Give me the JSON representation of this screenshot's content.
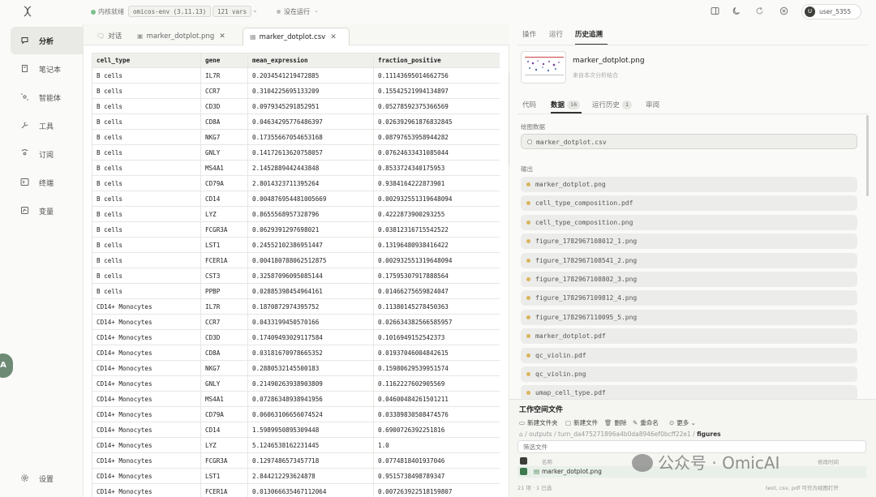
{
  "topbar": {
    "kernel_status": "内核就绪",
    "env_chip": "omicos-env (3.11.13)",
    "vars_chip": "121 vars",
    "run_status": "没在运行",
    "user_initial": "U",
    "user_name": "user_5355"
  },
  "sidebar": {
    "items": [
      {
        "label": "分析",
        "icon": "chat-icon"
      },
      {
        "label": "笔记本",
        "icon": "notebook-icon"
      },
      {
        "label": "智能体",
        "icon": "agent-icon"
      },
      {
        "label": "工具",
        "icon": "wrench-icon"
      },
      {
        "label": "订阅",
        "icon": "subscribe-icon"
      },
      {
        "label": "终端",
        "icon": "terminal-icon"
      },
      {
        "label": "变量",
        "icon": "variable-icon"
      }
    ],
    "settings_label": "设置",
    "float_letter": "A"
  },
  "center": {
    "tabs": [
      {
        "label": "对话",
        "icon": "chat-icon"
      },
      {
        "label": "marker_dotplot.png",
        "icon": "image-icon"
      },
      {
        "label": "marker_dotplot.csv",
        "icon": "table-icon"
      }
    ],
    "table": {
      "headers": [
        "cell_type",
        "gene",
        "mean_expression",
        "fraction_positive"
      ],
      "rows": [
        [
          "B cells",
          "IL7R",
          "0.2034541219472885",
          "0.11143695014662756"
        ],
        [
          "B cells",
          "CCR7",
          "0.3104225695133209",
          "0.15542521994134897"
        ],
        [
          "B cells",
          "CD3D",
          "0.0979345291852951",
          "0.05278592375366569"
        ],
        [
          "B cells",
          "CD8A",
          "0.04634295776486397",
          "0.026392961876832845"
        ],
        [
          "B cells",
          "NKG7",
          "0.17355667054653168",
          "0.08797653958944282"
        ],
        [
          "B cells",
          "GNLY",
          "0.14172613620758057",
          "0.07624633431085044"
        ],
        [
          "B cells",
          "MS4A1",
          "2.1452889442443848",
          "0.8533724340175953"
        ],
        [
          "B cells",
          "CD79A",
          "2.8014323711395264",
          "0.9384164222873901"
        ],
        [
          "B cells",
          "CD14",
          "0.004876954481005669",
          "0.002932551319648094"
        ],
        [
          "B cells",
          "LYZ",
          "0.8655568957328796",
          "0.4222873900293255"
        ],
        [
          "B cells",
          "FCGR3A",
          "0.0629391297698021",
          "0.03812316715542522"
        ],
        [
          "B cells",
          "LST1",
          "0.24552102386951447",
          "0.13196480938416422"
        ],
        [
          "B cells",
          "FCER1A",
          "0.004180788062512875",
          "0.002932551319648094"
        ],
        [
          "B cells",
          "CST3",
          "0.32587096095085144",
          "0.17595307917888564"
        ],
        [
          "B cells",
          "PPBP",
          "0.02885398454964161",
          "0.01466275659824047"
        ],
        [
          "CD14+ Monocytes",
          "IL7R",
          "0.1870872974395752",
          "0.11380145278450363"
        ],
        [
          "CD14+ Monocytes",
          "CCR7",
          "0.0433199450570166",
          "0.026634382566585957"
        ],
        [
          "CD14+ Monocytes",
          "CD3D",
          "0.17409493029117584",
          "0.1016949152542373"
        ],
        [
          "CD14+ Monocytes",
          "CD8A",
          "0.03181670978665352",
          "0.01937046004842615"
        ],
        [
          "CD14+ Monocytes",
          "NKG7",
          "0.2880532145500183",
          "0.15980629539951574"
        ],
        [
          "CD14+ Monocytes",
          "GNLY",
          "0.21490263938903809",
          "0.1162227602905569"
        ],
        [
          "CD14+ Monocytes",
          "MS4A1",
          "0.07286348938941956",
          "0.04600484261501211"
        ],
        [
          "CD14+ Monocytes",
          "CD79A",
          "0.06063106656074524",
          "0.03389830508474576"
        ],
        [
          "CD14+ Monocytes",
          "CD14",
          "1.5989950895309448",
          "0.6900726392251816"
        ],
        [
          "CD14+ Monocytes",
          "LYZ",
          "5.1246538162231445",
          "1.0"
        ],
        [
          "CD14+ Monocytes",
          "FCGR3A",
          "0.1297486573457718",
          "0.0774818401937046"
        ],
        [
          "CD14+ Monocytes",
          "LST1",
          "2.844212293624878",
          "0.9515738498789347"
        ],
        [
          "CD14+ Monocytes",
          "FCER1A",
          "0.013066635467112064",
          "0.007263922518159807"
        ]
      ]
    }
  },
  "right": {
    "tabs": [
      "操作",
      "运行",
      "历史追溯"
    ],
    "file_title": "marker_dotplot.png",
    "file_subtitle": "来自本次分析结合",
    "subtabs": [
      {
        "label": "代码",
        "badge": ""
      },
      {
        "label": "数据",
        "badge": "16"
      },
      {
        "label": "运行历史",
        "badge": "1"
      },
      {
        "label": "审阅",
        "badge": ""
      }
    ],
    "plot_data_label": "绘图数据",
    "plot_data_file": "marker_dotplot.csv",
    "outputs_label": "输出",
    "outputs": [
      "marker_dotplot.png",
      "cell_type_composition.pdf",
      "cell_type_composition.png",
      "figure_1782967108012_1.png",
      "figure_1782967108541_2.png",
      "figure_1782967108802_3.png",
      "figure_1782967109812_4.png",
      "figure_1782967110095_5.png",
      "marker_dotplot.pdf",
      "qc_violin.pdf",
      "qc_violin.png",
      "umap_cell_type.pdf"
    ]
  },
  "workspace": {
    "title": "工作空间文件",
    "actions": [
      "新建文件夹",
      "新建文件",
      "删除",
      "重命名",
      "更多"
    ],
    "path": [
      "outputs",
      "turn_da475271896a4b0da8946ef0bcff22e1",
      "figures"
    ],
    "filter_placeholder": "筛选文件",
    "col_name": "名称",
    "col_modified": "修改时间",
    "selected_file": "marker_dotplot.png",
    "footer_count": "21 项 · 1 已选",
    "footer_hint": "text, csv, pdf 可作为视图打开"
  },
  "watermark": "公众号 · OmicAI"
}
